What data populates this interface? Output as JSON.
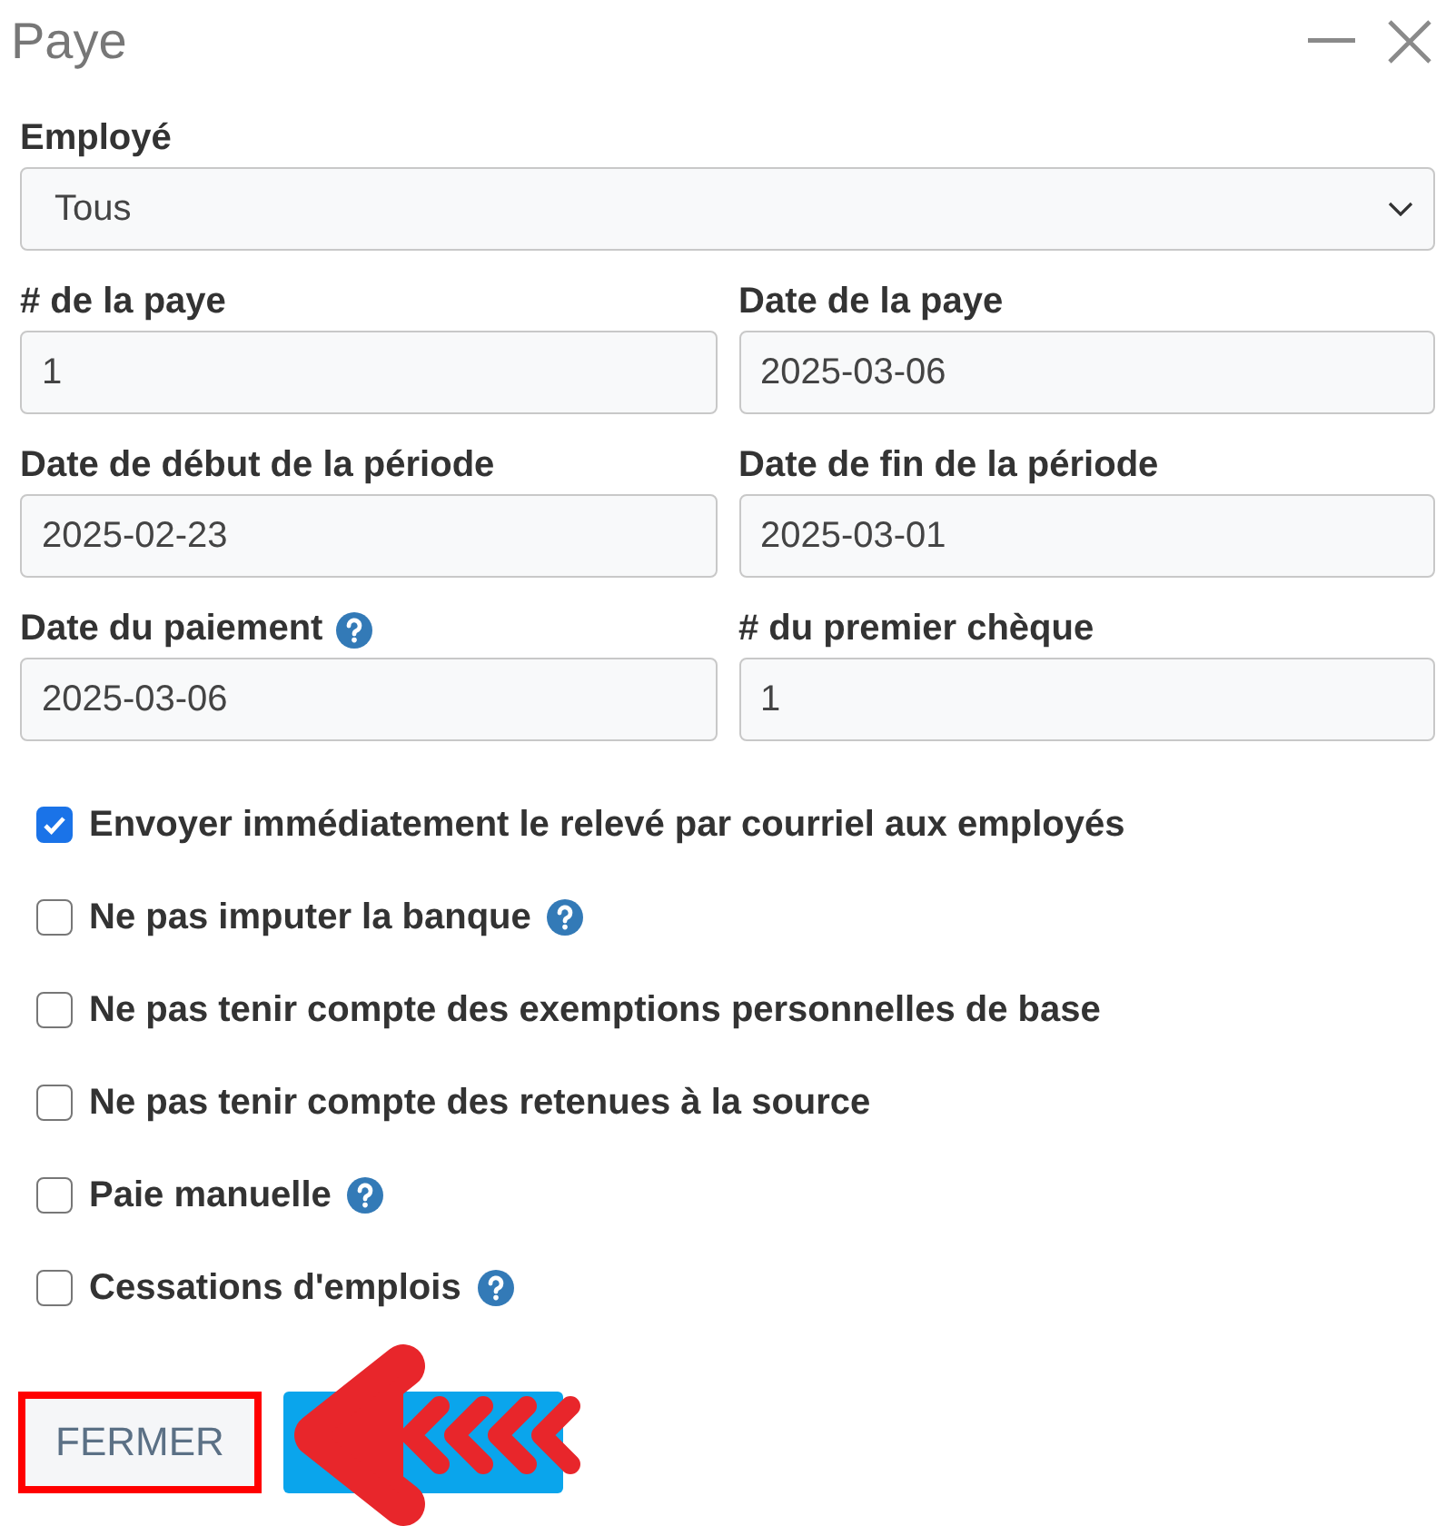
{
  "window": {
    "title": "Paye"
  },
  "employee": {
    "label": "Employé",
    "value": "Tous"
  },
  "fields": [
    {
      "label": "# de la paye",
      "value": "1",
      "help": false
    },
    {
      "label": "Date de la paye",
      "value": "2025-03-06",
      "help": false
    },
    {
      "label": "Date de début de la période",
      "value": "2025-02-23",
      "help": false
    },
    {
      "label": "Date de fin de la période",
      "value": "2025-03-01",
      "help": false
    },
    {
      "label": "Date du paiement",
      "value": "2025-03-06",
      "help": true
    },
    {
      "label": "# du premier chèque",
      "value": "1",
      "help": false
    }
  ],
  "options": [
    {
      "label": "Envoyer immédiatement le relevé par courriel aux employés",
      "checked": true,
      "help": false
    },
    {
      "label": "Ne pas imputer la banque",
      "checked": false,
      "help": true
    },
    {
      "label": "Ne pas tenir compte des exemptions personnelles de base",
      "checked": false,
      "help": false
    },
    {
      "label": "Ne pas tenir compte des retenues à la source",
      "checked": false,
      "help": false
    },
    {
      "label": "Paie manuelle",
      "checked": false,
      "help": true
    },
    {
      "label": "Cessations d'emplois",
      "checked": false,
      "help": true
    }
  ],
  "buttons": [
    {
      "kind": "secondary",
      "label": "FERMER",
      "highlighted": true
    },
    {
      "kind": "primary",
      "highlighted": false
    }
  ],
  "annotation": {
    "kind": "arrow"
  }
}
